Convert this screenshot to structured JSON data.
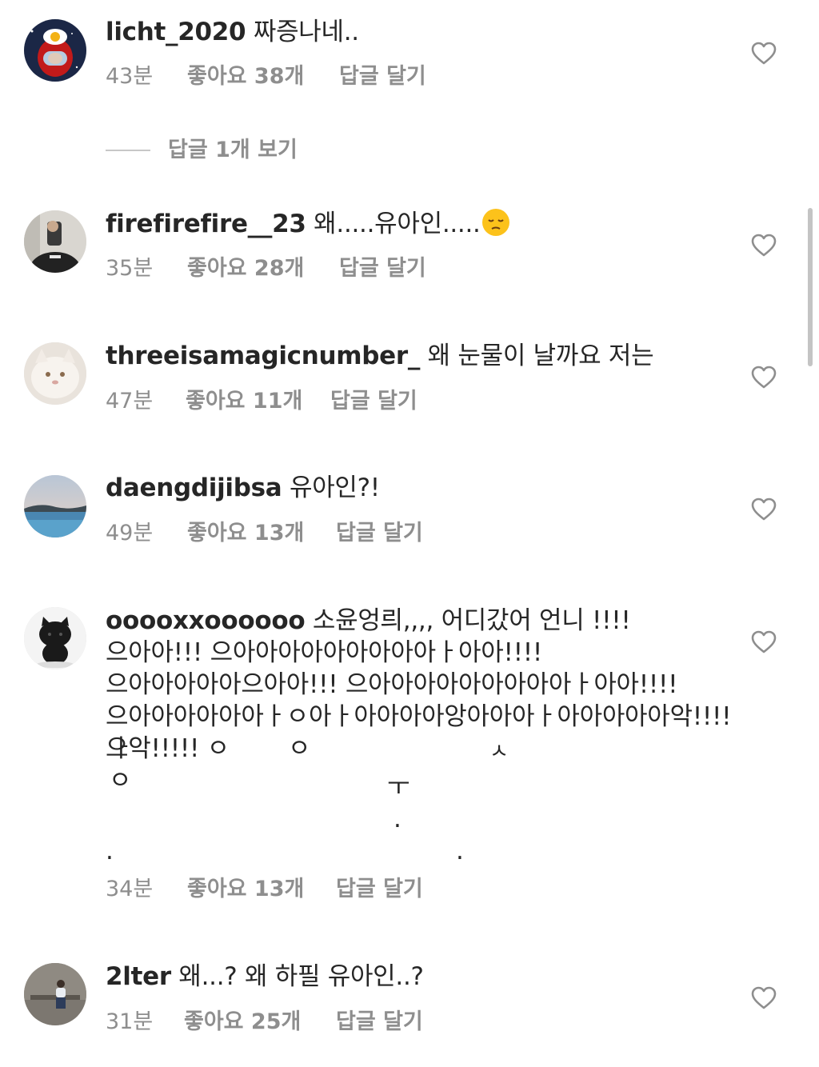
{
  "comments": [
    {
      "username": "licht_2020",
      "text": " 짜증나네..",
      "time": "43분",
      "likes": "좋아요 38개",
      "reply": "답글 달기",
      "avatar": "among-us-avatar",
      "view_replies": "답글 1개 보기"
    },
    {
      "username": "firefirefire__23",
      "text": " 왜.....유아인.....",
      "emoji": "pensive-face",
      "time": "35분",
      "likes": "좋아요 28개",
      "reply": "답글 달기",
      "avatar": "mirror-selfie-avatar"
    },
    {
      "username": "threeisamagicnumber_",
      "text": " 왜 눈물이 날까요 저는",
      "time": "47분",
      "likes": "좋아요 11개",
      "reply": "답글 달기",
      "avatar": "white-cat-avatar"
    },
    {
      "username": "daengdijibsa",
      "text": " 유아인?!",
      "time": "49분",
      "likes": "좋아요 13개",
      "reply": "답글 달기",
      "avatar": "infinity-pool-avatar"
    },
    {
      "username": "ooooxxoooooo",
      "text": " 소윤엉릐,,,, 어디갔어 언니 !!!! 으아아!!! 으아아아아아아아아아ㅏ아아!!!! 으아아아아아으아아!!! 으아아아아아아아아아ㅏ아아!!!! 으아아아아아아ㅏㅇ아ㅏ아아아아앙아아아ㅏ아아아아아악!!!! 으악!!!!! ㅇ",
      "scattered": [
        "ㅏ",
        "ㅇ",
        "ㅅ",
        "ㅇ",
        "ㅜ",
        ".",
        ".",
        "."
      ],
      "time": "34분",
      "likes": "좋아요 13개",
      "reply": "답글 달기",
      "avatar": "black-kitty-plush-avatar"
    },
    {
      "username": "2lter",
      "text": " 왜...? 왜 하필 유아인..?",
      "time": "31분",
      "likes": "좋아요 25개",
      "reply": "답글 달기",
      "avatar": "sitting-person-avatar"
    }
  ],
  "icons": {
    "like": "heart-outline-icon"
  },
  "colors": {
    "text": "#262626",
    "secondary": "#8e8e8e",
    "divider": "#c7c7c7"
  }
}
